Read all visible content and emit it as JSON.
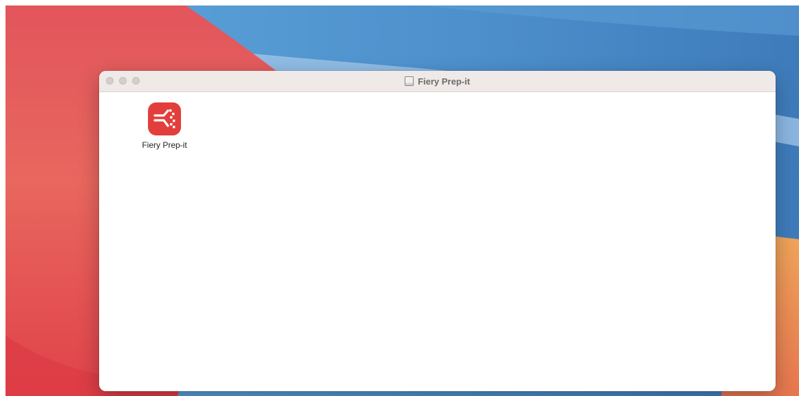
{
  "window": {
    "title": "Fiery Prep-it"
  },
  "files": [
    {
      "label": "Fiery Prep-it",
      "icon": "fiery-prep-it-app-icon"
    }
  ],
  "colors": {
    "icon_red": "#e23f3c",
    "titlebar": "#efe9e8"
  }
}
